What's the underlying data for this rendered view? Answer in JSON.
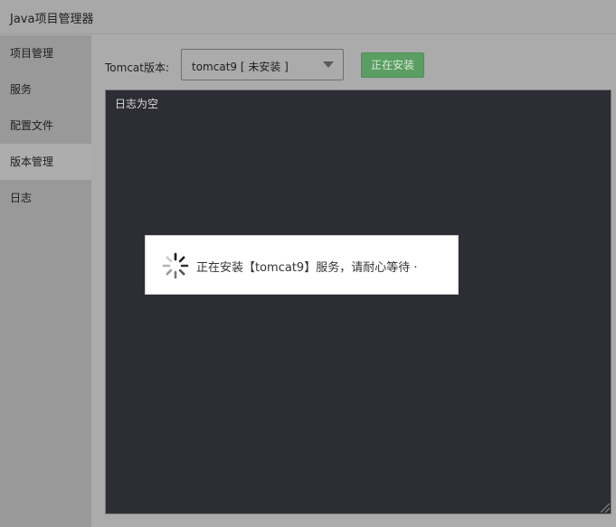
{
  "window": {
    "title": "Java项目管理器"
  },
  "sidebar": {
    "items": [
      {
        "label": "项目管理"
      },
      {
        "label": "服务"
      },
      {
        "label": "配置文件"
      },
      {
        "label": "版本管理"
      },
      {
        "label": "日志"
      }
    ],
    "active_index": 3
  },
  "version_panel": {
    "label": "Tomcat版本:",
    "select_value": "tomcat9 [ 未安装 ]",
    "install_button": "正在安装"
  },
  "log": {
    "empty_text": "日志为空"
  },
  "toast": {
    "message": "正在安装【tomcat9】服务，请耐心等待 ·",
    "icon": "loading-spinner-icon"
  },
  "colors": {
    "accent": "#5a9e62",
    "log_background": "#2d2d35",
    "overlay_gray": "#ababab"
  }
}
